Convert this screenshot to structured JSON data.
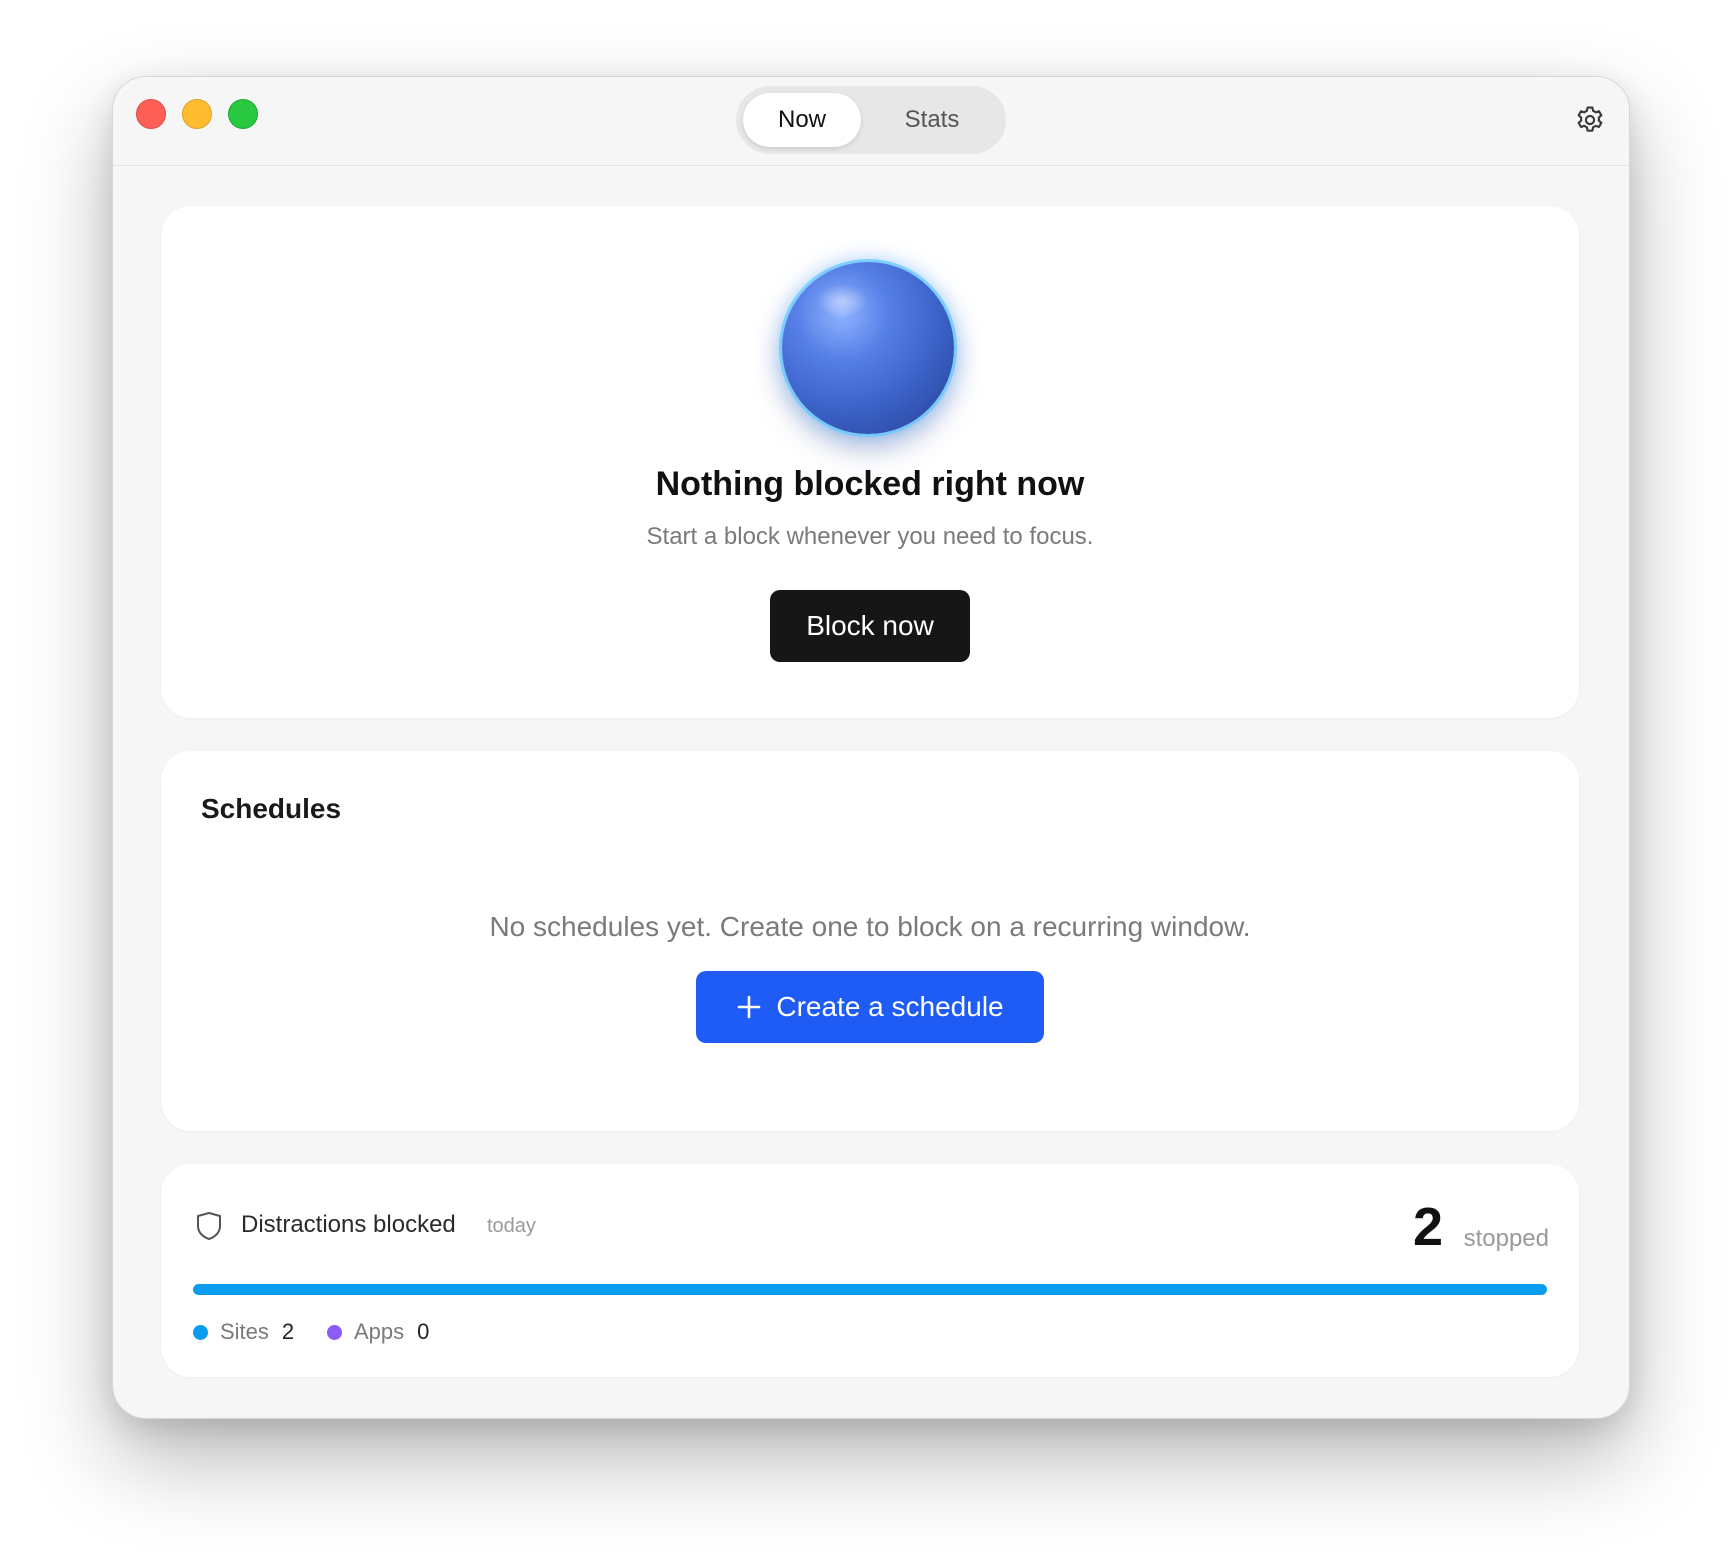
{
  "tabs": [
    {
      "label": "Now",
      "active": true
    },
    {
      "label": "Stats",
      "active": false
    }
  ],
  "status": {
    "title": "Nothing blocked right now",
    "subtitle": "Start a block whenever you need to focus.",
    "button_label": "Block now"
  },
  "schedules": {
    "title": "Schedules",
    "empty_message": "No schedules yet. Create one to block on a recurring window.",
    "create_label": "Create a schedule"
  },
  "stats": {
    "label": "Distractions blocked",
    "period": "today",
    "count": "2",
    "count_unit": "stopped",
    "sites_share": 1.0,
    "legend": [
      {
        "label": "Sites",
        "value": "2",
        "color": "#0a9cf0"
      },
      {
        "label": "Apps",
        "value": "0",
        "color": "#8b5cf6"
      }
    ]
  },
  "colors": {
    "primary_button": "#1e5cf5",
    "dark_button": "#161616",
    "orb": "#3c63c9"
  },
  "icons": {
    "settings": "gear-icon",
    "add": "plus-icon",
    "stats": "shield-icon"
  }
}
